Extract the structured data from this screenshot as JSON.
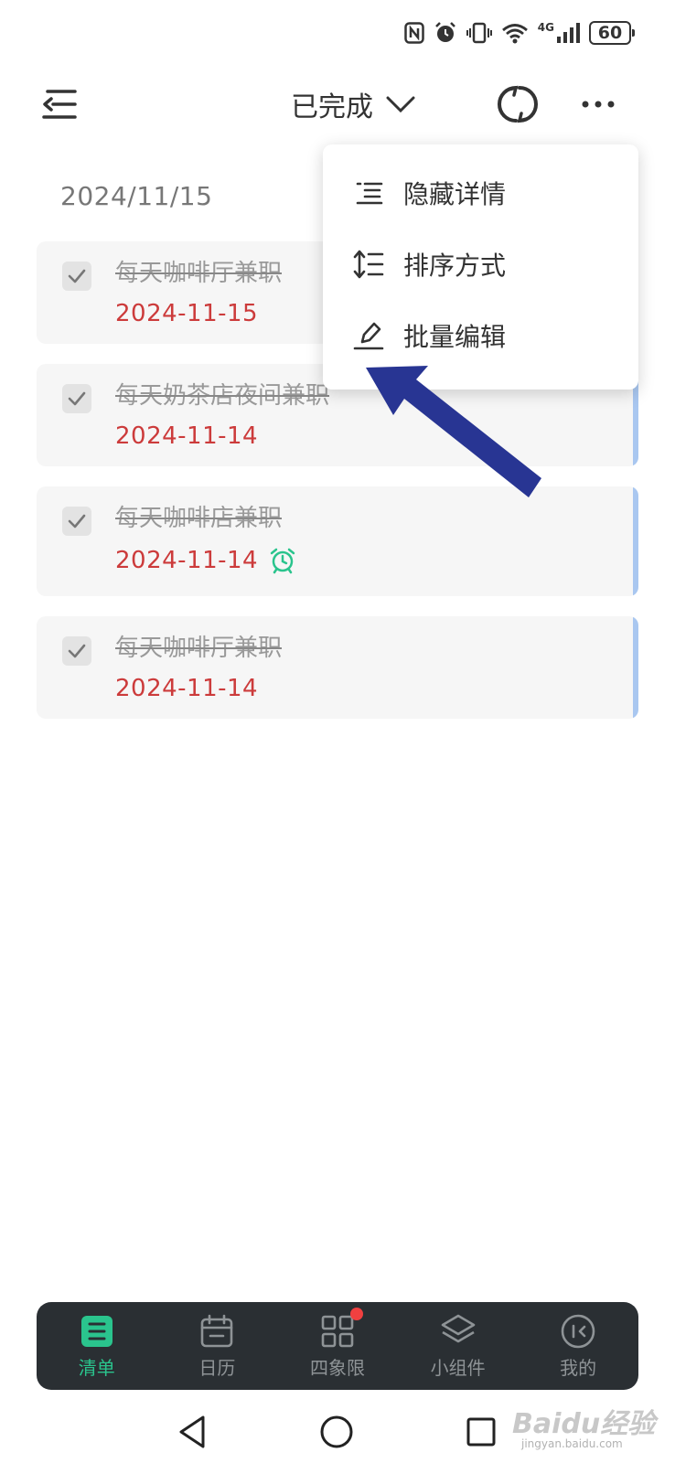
{
  "status_bar": {
    "battery": "60",
    "network": "4G"
  },
  "header": {
    "title": "已完成"
  },
  "date_group": "2024/11/15",
  "tasks": [
    {
      "title": "每天咖啡厅兼职",
      "date": "2024-11-15",
      "done": true,
      "alarm": false
    },
    {
      "title": "每天奶茶店夜间兼职",
      "date": "2024-11-14",
      "done": true,
      "alarm": false
    },
    {
      "title": "每天咖啡店兼职",
      "date": "2024-11-14",
      "done": true,
      "alarm": true
    },
    {
      "title": "每天咖啡厅兼职",
      "date": "2024-11-14",
      "done": true,
      "alarm": false
    }
  ],
  "menu": {
    "items": [
      {
        "label": "隐藏详情",
        "icon": "list-detail-icon"
      },
      {
        "label": "排序方式",
        "icon": "sort-icon"
      },
      {
        "label": "批量编辑",
        "icon": "edit-pen-icon"
      }
    ]
  },
  "bottom_nav": {
    "items": [
      {
        "label": "清单",
        "icon": "list-icon",
        "active": true
      },
      {
        "label": "日历",
        "icon": "calendar-icon",
        "active": false
      },
      {
        "label": "四象限",
        "icon": "grid-icon",
        "active": false,
        "badge": true
      },
      {
        "label": "小组件",
        "icon": "layers-icon",
        "active": false
      },
      {
        "label": "我的",
        "icon": "profile-icon",
        "active": false
      }
    ]
  },
  "colors": {
    "accent_green": "#2ac48d",
    "date_red": "#cc3b3b",
    "card_accent_blue": "#a9c7f0",
    "nav_bg": "#2a2f33",
    "arrow_blue": "#283593"
  },
  "watermark": {
    "brand": "Baidu经验",
    "url": "jingyan.baidu.com"
  }
}
